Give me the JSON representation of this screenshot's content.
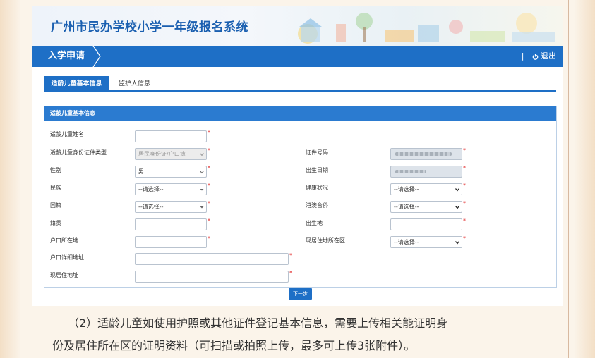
{
  "header": {
    "title": "广州市民办学校小学一年级报名系统"
  },
  "navbar": {
    "tab_label": "入学申请",
    "separator": "|",
    "logout_label": "退出"
  },
  "tabs": [
    {
      "label": "适龄儿童基本信息",
      "active": true
    },
    {
      "label": "监护人信息",
      "active": false
    }
  ],
  "panel": {
    "title": "适龄儿童基本信息",
    "fields": {
      "child_name": {
        "label": "适龄儿童姓名",
        "value": ""
      },
      "id_type": {
        "label": "适龄儿童身份证件类型",
        "value": "居民身份证/户口簿"
      },
      "id_number": {
        "label": "证件号码",
        "value": ""
      },
      "gender": {
        "label": "性别",
        "value": "男"
      },
      "birth_date": {
        "label": "出生日期",
        "value": ""
      },
      "ethnicity": {
        "label": "民族",
        "value": "--请选择--"
      },
      "health": {
        "label": "健康状况",
        "value": "--请选择--"
      },
      "nationality": {
        "label": "国籍",
        "value": "--请选择--"
      },
      "hk_macao_tw": {
        "label": "港澳台侨",
        "value": "--请选择--"
      },
      "native_place": {
        "label": "籍贯",
        "value": ""
      },
      "birthplace": {
        "label": "出生地",
        "value": ""
      },
      "hukou_location": {
        "label": "户口所在地",
        "value": ""
      },
      "residence_district": {
        "label": "现居住地所在区",
        "value": "--请选择--"
      },
      "hukou_address": {
        "label": "户口详细地址",
        "value": ""
      },
      "current_address": {
        "label": "现居住地址",
        "value": ""
      }
    },
    "required_mark": "*"
  },
  "actions": {
    "next_label": "下一步"
  },
  "caption": {
    "line1": "（2）适龄儿童如使用护照或其他证件登记基本信息，需要上传相关能证明身",
    "line2": "份及居住所在区的证明资料（可扫描或拍照上传，最多可上传3张附件）。"
  },
  "colors": {
    "primary": "#1e6fc6",
    "banner_title": "#1a5fb0",
    "required": "#e02020"
  }
}
